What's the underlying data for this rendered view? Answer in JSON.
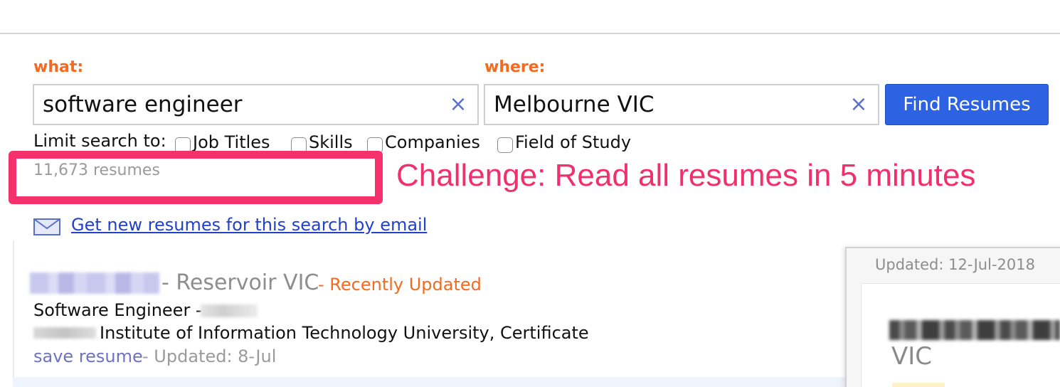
{
  "search": {
    "what_label": "what:",
    "what_value": "software engineer",
    "where_label": "where:",
    "where_value": "Melbourne VIC",
    "clear_glyph": "×",
    "find_button": "Find Resumes"
  },
  "limit": {
    "label": "Limit search to:",
    "options": [
      "Job Titles",
      "Skills",
      "Companies",
      "Field of Study"
    ]
  },
  "results": {
    "count": "11,673 resumes",
    "email_link": "Get new resumes for this search by email"
  },
  "annotation": {
    "challenge": "Challenge: Read all resumes in 5 minutes"
  },
  "result_item": {
    "location": "- Reservoir VIC",
    "recent": "- Recently Updated",
    "title": "Software Engineer -",
    "education": "Institute of Information Technology University, Certificate",
    "save": "save resume",
    "updated": "- Updated: 8-Jul"
  },
  "preview": {
    "updated": "Updated: 12-Jul-2018",
    "location": "VIC"
  },
  "colors": {
    "accent_orange": "#f26b21",
    "button_blue": "#2d63e3",
    "link_blue": "#2241c9",
    "highlight_pink": "#f4316c"
  },
  "icons": [
    "clear-x-icon",
    "mail-envelope-icon"
  ]
}
